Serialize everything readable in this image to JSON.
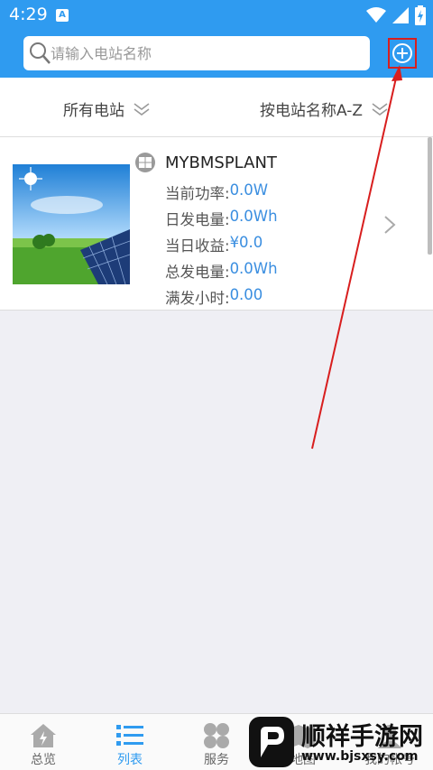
{
  "status_bar": {
    "time": "4:29",
    "notification": "A"
  },
  "header": {
    "search_placeholder": "请输入电站名称"
  },
  "filters": {
    "all_plants": "所有电站",
    "sort": "按电站名称A-Z"
  },
  "plant": {
    "name": "MYBMSPLANT",
    "rows": [
      {
        "label": "当前功率:",
        "value": "0.0W"
      },
      {
        "label": "日发电量:",
        "value": "0.0Wh"
      },
      {
        "label": "当日收益:",
        "value": "¥0.0"
      },
      {
        "label": "总发电量:",
        "value": "0.0Wh"
      },
      {
        "label": "满发小时:",
        "value": "0.00"
      }
    ]
  },
  "nav": [
    {
      "label": "总览",
      "icon": "home-icon"
    },
    {
      "label": "列表",
      "icon": "list-icon",
      "active": true
    },
    {
      "label": "服务",
      "icon": "clover-icon"
    },
    {
      "label": "地图",
      "icon": "map-icon"
    },
    {
      "label": "我的帐号",
      "icon": "account-icon"
    }
  ],
  "watermark": {
    "title": "顺祥手游网",
    "url": "www.bjsxsy.com"
  },
  "colors": {
    "primary": "#2f9bf0",
    "value_blue": "#3a8ee0",
    "annotation_red": "#d81e1e"
  }
}
